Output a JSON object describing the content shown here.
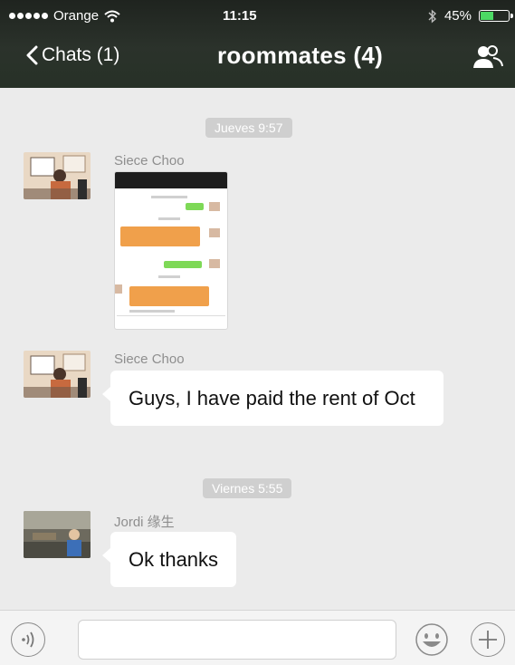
{
  "status_bar": {
    "carrier": "Orange",
    "time": "11:15",
    "battery": "45%",
    "battery_level": 0.45
  },
  "nav": {
    "back_label": "Chats (1)",
    "title": "roommates (4)"
  },
  "messages": [
    {
      "type": "timestamp",
      "text": "Jueves 9:57"
    },
    {
      "type": "image",
      "sender": "Siece Choo"
    },
    {
      "type": "text",
      "sender": "Siece Choo",
      "text": "Guys, I have paid the rent of Oct"
    },
    {
      "type": "timestamp",
      "text": "Viernes 5:55"
    },
    {
      "type": "text",
      "sender": "Jordi 缘生",
      "text": "Ok thanks"
    }
  ],
  "input_bar": {
    "placeholder": "",
    "icons": [
      "voice-icon",
      "emoji-icon",
      "plus-icon"
    ]
  },
  "colors": {
    "header_bg": "#2b322b",
    "chat_bg": "#ebebeb",
    "bubble_bg": "#ffffff",
    "timestamp_bg": "#cfcfcf",
    "battery_green": "#4cd964"
  }
}
